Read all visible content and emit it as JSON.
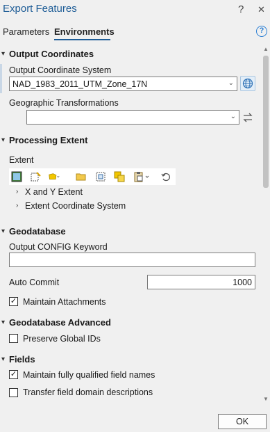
{
  "window": {
    "title": "Export Features",
    "help_glyph": "?",
    "close_glyph": "✕"
  },
  "tabs": [
    {
      "label": "Parameters"
    },
    {
      "label": "Environments"
    }
  ],
  "help_icon_glyph": "?",
  "sections": {
    "output_coordinates": {
      "header": "Output Coordinates",
      "ocs_label": "Output Coordinate System",
      "ocs_value": "NAD_1983_2011_UTM_Zone_17N",
      "geo_label": "Geographic Transformations",
      "geo_value": ""
    },
    "processing_extent": {
      "header": "Processing Extent",
      "extent_label": "Extent",
      "xy_extent": "X and Y Extent",
      "extent_cs": "Extent Coordinate System"
    },
    "geodatabase": {
      "header": "Geodatabase",
      "config_label": "Output CONFIG Keyword",
      "config_value": "",
      "auto_commit_label": "Auto Commit",
      "auto_commit_value": "1000",
      "maintain_attachments_label": "Maintain Attachments",
      "maintain_attachments_checked": true
    },
    "geodatabase_advanced": {
      "header": "Geodatabase Advanced",
      "preserve_ids_label": "Preserve Global IDs",
      "preserve_ids_checked": false
    },
    "fields": {
      "header": "Fields",
      "qualified_label": "Maintain fully qualified field names",
      "qualified_checked": true,
      "domain_label": "Transfer field domain descriptions",
      "domain_checked": false
    }
  },
  "ok_label": "OK",
  "colors": {
    "accent": "#1d5c96",
    "help": "#2a7fd4"
  }
}
